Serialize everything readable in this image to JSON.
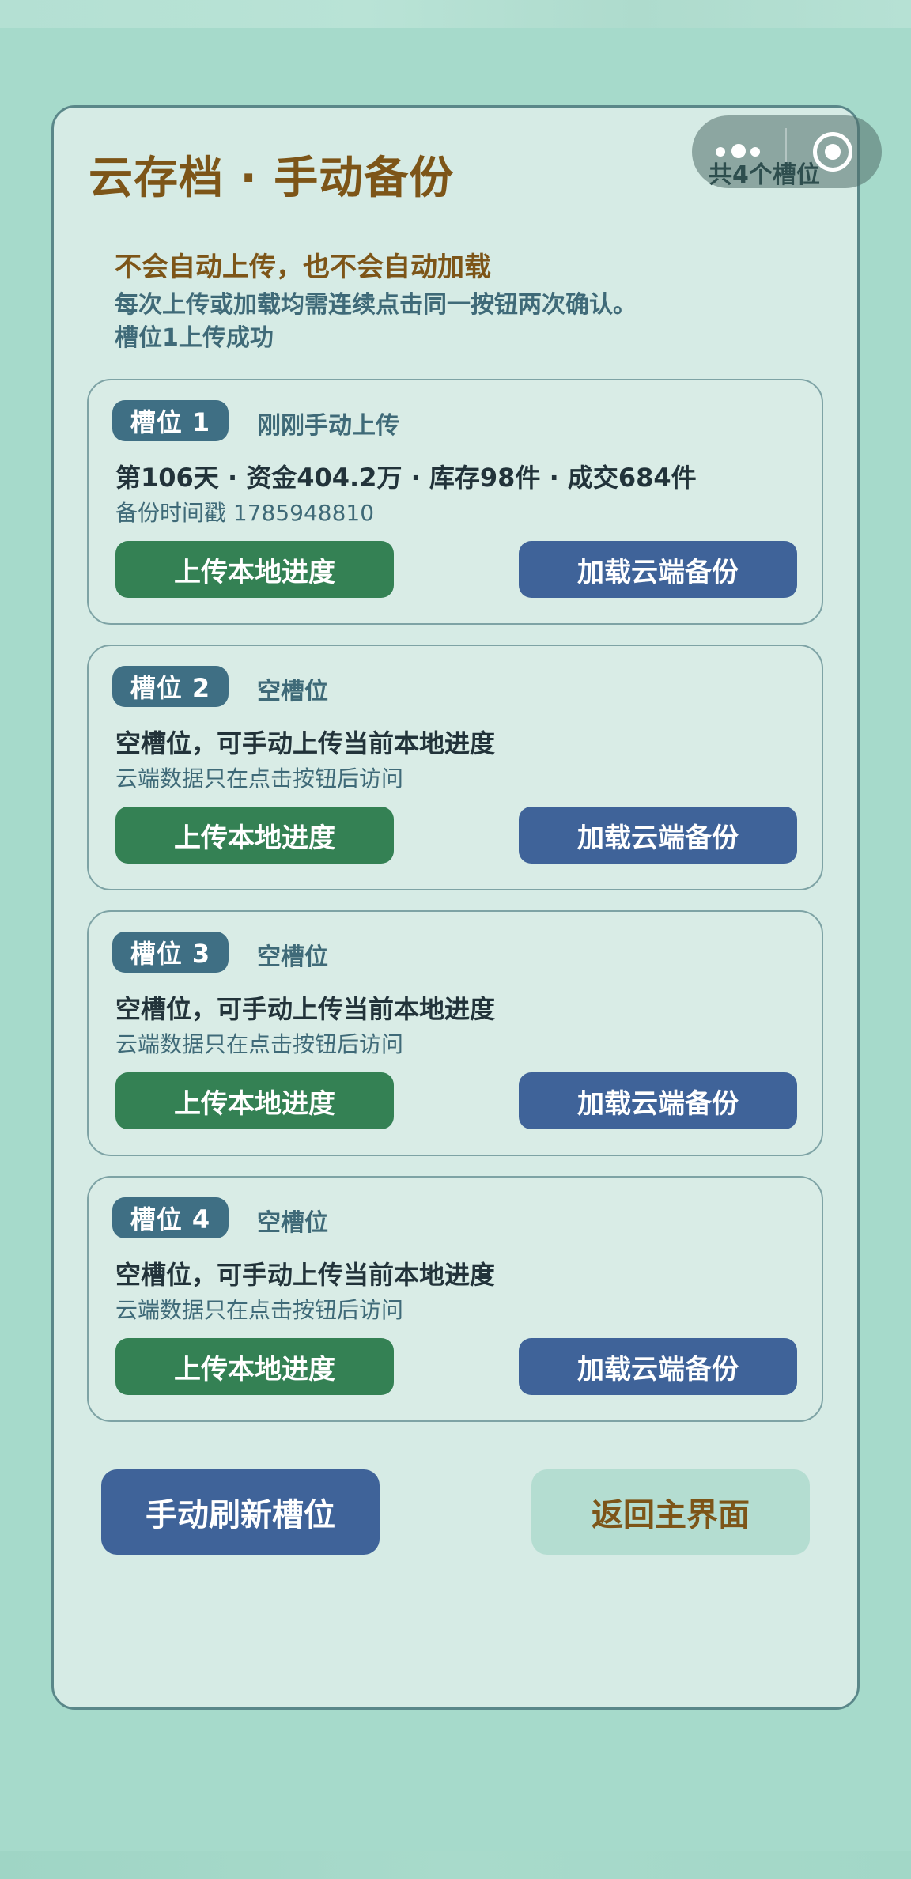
{
  "header": {
    "title": "云存档 · 手动备份",
    "slot_count": "共4个槽位"
  },
  "capsule": {
    "more_icon": "more-dots-icon",
    "close_icon": "target-circle-icon"
  },
  "notice": {
    "line1": "不会自动上传，也不会自动加载",
    "line2": "每次上传或加载均需连续点击同一按钮两次确认。",
    "line3": "槽位1上传成功"
  },
  "slots": [
    {
      "badge": "槽位 1",
      "status": "刚刚手动上传",
      "main": "第106天 · 资金404.2万 · 库存98件 · 成交684件",
      "sub": "备份时间戳 1785948810",
      "upload_label": "上传本地进度",
      "load_label": "加载云端备份"
    },
    {
      "badge": "槽位 2",
      "status": "空槽位",
      "main": "空槽位，可手动上传当前本地进度",
      "sub": "云端数据只在点击按钮后访问",
      "upload_label": "上传本地进度",
      "load_label": "加载云端备份"
    },
    {
      "badge": "槽位 3",
      "status": "空槽位",
      "main": "空槽位，可手动上传当前本地进度",
      "sub": "云端数据只在点击按钮后访问",
      "upload_label": "上传本地进度",
      "load_label": "加载云端备份"
    },
    {
      "badge": "槽位 4",
      "status": "空槽位",
      "main": "空槽位，可手动上传当前本地进度",
      "sub": "云端数据只在点击按钮后访问",
      "upload_label": "上传本地进度",
      "load_label": "加载云端备份"
    }
  ],
  "footer": {
    "refresh_label": "手动刷新槽位",
    "back_label": "返回主界面"
  },
  "colors": {
    "background": "#a6dacb",
    "panel": "#d6ebe5",
    "title": "#7d5518",
    "upload_button": "#348154",
    "load_button": "#3f6399",
    "badge": "#3f6f84"
  }
}
